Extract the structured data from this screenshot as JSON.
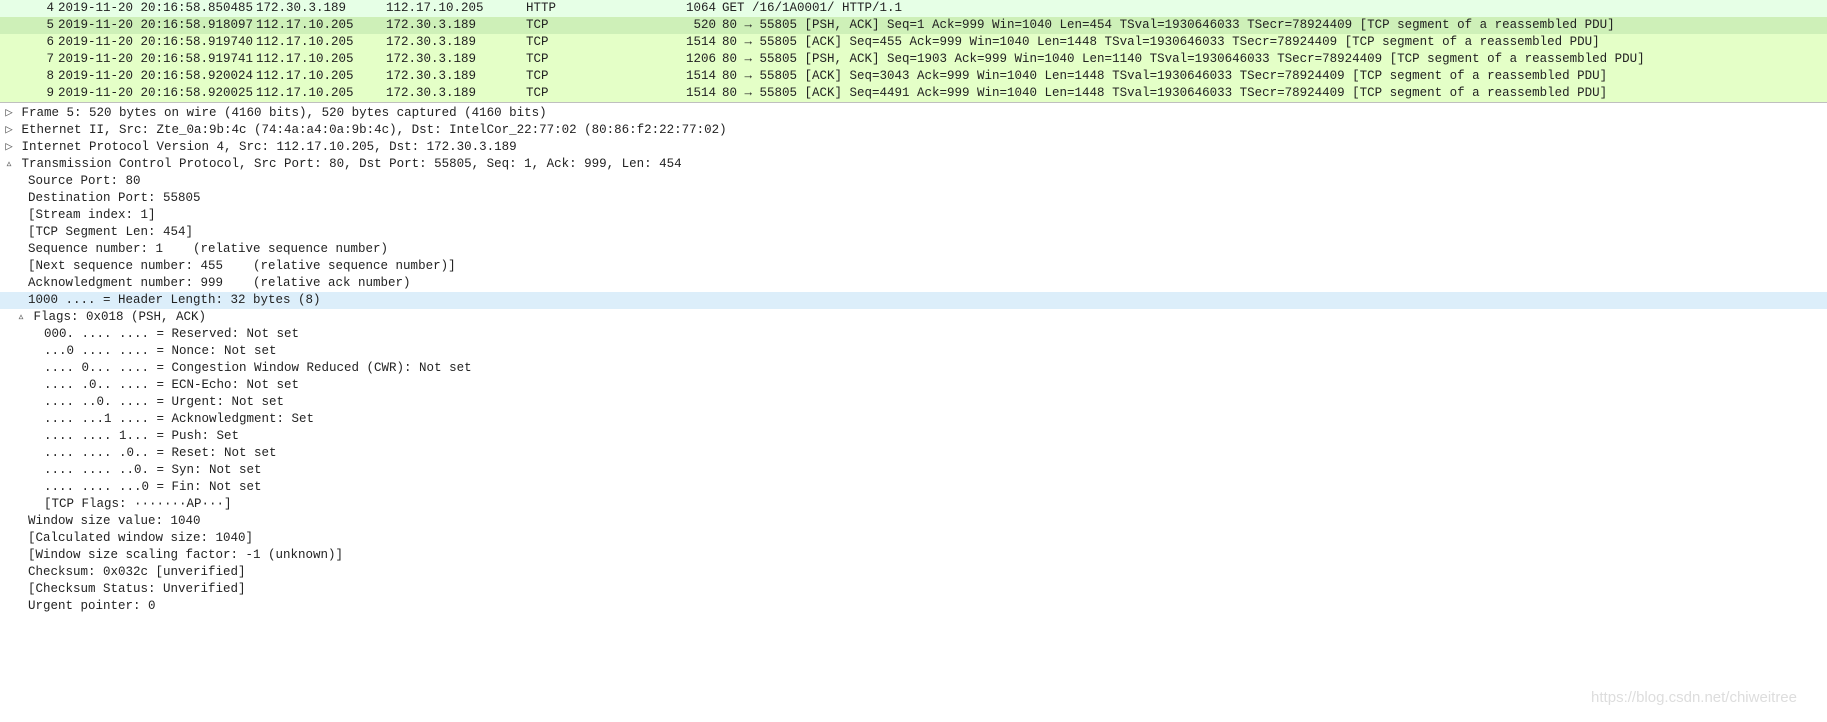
{
  "packets": [
    {
      "no": "4",
      "time": "2019-11-20 20:16:58.850485",
      "src": "172.30.3.189",
      "dst": "112.17.10.205",
      "prot": "HTTP",
      "len": "1064",
      "info": "GET /16/1A0001/ HTTP/1.1",
      "cls": "bg-http"
    },
    {
      "no": "5",
      "time": "2019-11-20 20:16:58.918097",
      "src": "112.17.10.205",
      "dst": "172.30.3.189",
      "prot": "TCP",
      "len": "520",
      "info": "80 → 55805 [PSH, ACK] Seq=1 Ack=999 Win=1040 Len=454 TSval=1930646033 TSecr=78924409 [TCP segment of a reassembled PDU]",
      "cls": "bg-httpsel"
    },
    {
      "no": "6",
      "time": "2019-11-20 20:16:58.919740",
      "src": "112.17.10.205",
      "dst": "172.30.3.189",
      "prot": "TCP",
      "len": "1514",
      "info": "80 → 55805 [ACK] Seq=455 Ack=999 Win=1040 Len=1448 TSval=1930646033 TSecr=78924409 [TCP segment of a reassembled PDU]",
      "cls": "bg-tcp"
    },
    {
      "no": "7",
      "time": "2019-11-20 20:16:58.919741",
      "src": "112.17.10.205",
      "dst": "172.30.3.189",
      "prot": "TCP",
      "len": "1206",
      "info": "80 → 55805 [PSH, ACK] Seq=1903 Ack=999 Win=1040 Len=1140 TSval=1930646033 TSecr=78924409 [TCP segment of a reassembled PDU]",
      "cls": "bg-tcp"
    },
    {
      "no": "8",
      "time": "2019-11-20 20:16:58.920024",
      "src": "112.17.10.205",
      "dst": "172.30.3.189",
      "prot": "TCP",
      "len": "1514",
      "info": "80 → 55805 [ACK] Seq=3043 Ack=999 Win=1040 Len=1448 TSval=1930646033 TSecr=78924409 [TCP segment of a reassembled PDU]",
      "cls": "bg-tcp"
    },
    {
      "no": "9",
      "time": "2019-11-20 20:16:58.920025",
      "src": "112.17.10.205",
      "dst": "172.30.3.189",
      "prot": "TCP",
      "len": "1514",
      "info": "80 → 55805 [ACK] Seq=4491 Ack=999 Win=1040 Len=1448 TSval=1930646033 TSecr=78924409 [TCP segment of a reassembled PDU]",
      "cls": "bg-tcp"
    }
  ],
  "tree": {
    "frame": "Frame 5: 520 bytes on wire (4160 bits), 520 bytes captured (4160 bits)",
    "eth": "Ethernet II, Src: Zte_0a:9b:4c (74:4a:a4:0a:9b:4c), Dst: IntelCor_22:77:02 (80:86:f2:22:77:02)",
    "ip": "Internet Protocol Version 4, Src: 112.17.10.205, Dst: 172.30.3.189",
    "tcp": "Transmission Control Protocol, Src Port: 80, Dst Port: 55805, Seq: 1, Ack: 999, Len: 454",
    "srcport": "Source Port: 80",
    "dstport": "Destination Port: 55805",
    "stream": "[Stream index: 1]",
    "seglen": "[TCP Segment Len: 454]",
    "seq": "Sequence number: 1    (relative sequence number)",
    "nseq": "[Next sequence number: 455    (relative sequence number)]",
    "ack": "Acknowledgment number: 999    (relative ack number)",
    "hdrlen": "1000 .... = Header Length: 32 bytes (8)",
    "flags": "Flags: 0x018 (PSH, ACK)",
    "f0": "000. .... .... = Reserved: Not set",
    "f1": "...0 .... .... = Nonce: Not set",
    "f2": ".... 0... .... = Congestion Window Reduced (CWR): Not set",
    "f3": ".... .0.. .... = ECN-Echo: Not set",
    "f4": ".... ..0. .... = Urgent: Not set",
    "f5": ".... ...1 .... = Acknowledgment: Set",
    "f6": ".... .... 1... = Push: Set",
    "f7": ".... .... .0.. = Reset: Not set",
    "f8": ".... .... ..0. = Syn: Not set",
    "f9": ".... .... ...0 = Fin: Not set",
    "ftxt": "[TCP Flags: ·······AP···]",
    "win": "Window size value: 1040",
    "cwin": "[Calculated window size: 1040]",
    "wscale": "[Window size scaling factor: -1 (unknown)]",
    "cksum": "Checksum: 0x032c [unverified]",
    "ckstat": "[Checksum Status: Unverified]",
    "urg": "Urgent pointer: 0"
  },
  "watermark": "https://blog.csdn.net/chiweitree"
}
